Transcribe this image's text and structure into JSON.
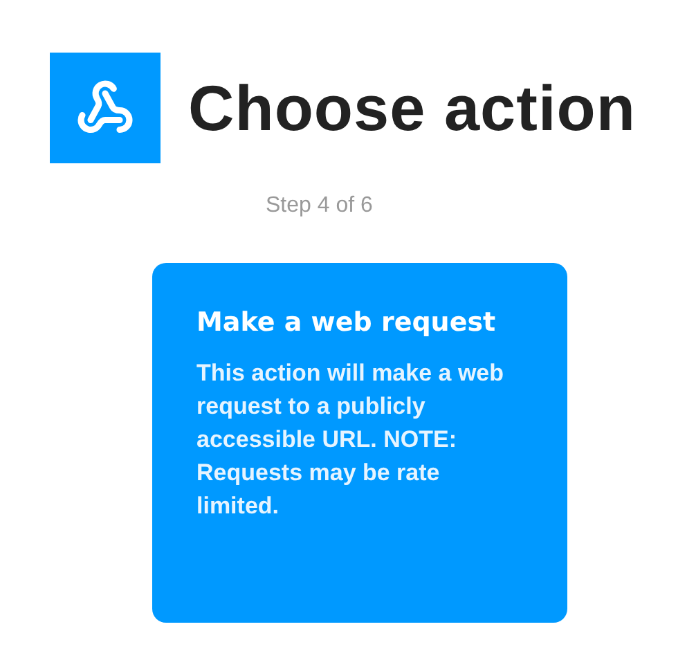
{
  "header": {
    "title": "Choose action",
    "step": "Step 4 of 6"
  },
  "action_card": {
    "title": "Make a web request",
    "description": "This action will make a web request to a publicly accessible URL. NOTE: Requests may be rate limited."
  }
}
